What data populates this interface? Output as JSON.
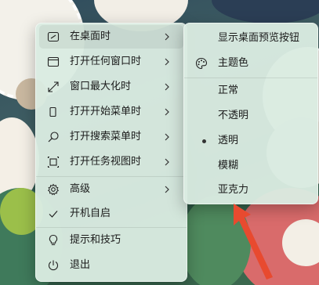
{
  "main_menu": {
    "items": [
      {
        "label": "在桌面时",
        "icon": "desktop-icon",
        "has_submenu": true,
        "highlighted": true
      },
      {
        "label": "打开任何窗口时",
        "icon": "window-icon",
        "has_submenu": true
      },
      {
        "label": "窗口最大化时",
        "icon": "maximize-icon",
        "has_submenu": true
      },
      {
        "label": "打开开始菜单时",
        "icon": "start-menu-icon",
        "has_submenu": true
      },
      {
        "label": "打开搜索菜单时",
        "icon": "search-icon",
        "has_submenu": true
      },
      {
        "label": "打开任务视图时",
        "icon": "task-view-icon",
        "has_submenu": true
      },
      {
        "label": "高级",
        "icon": "gear-icon",
        "has_submenu": true
      },
      {
        "label": "开机自启",
        "icon": "checkmark-icon",
        "checked": true
      },
      {
        "label": "提示和技巧",
        "icon": "lightbulb-icon"
      },
      {
        "label": "退出",
        "icon": "power-icon"
      }
    ]
  },
  "sub_menu": {
    "items": [
      {
        "label": "显示桌面预览按钮"
      },
      {
        "label": "主题色",
        "icon": "palette-icon"
      },
      {
        "label": "正常"
      },
      {
        "label": "不透明"
      },
      {
        "label": "透明",
        "selected": true
      },
      {
        "label": "模糊"
      },
      {
        "label": "亚克力"
      }
    ]
  },
  "colors": {
    "menu_bg": "#daebe1",
    "annotation_arrow": "#e84a2f"
  }
}
